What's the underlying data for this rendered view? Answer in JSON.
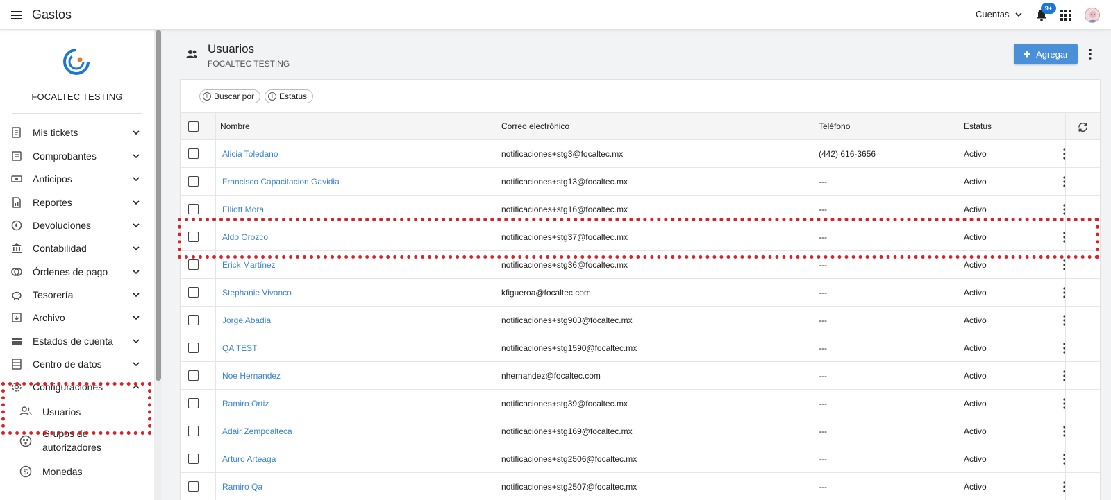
{
  "topbar": {
    "app_title": "Gastos",
    "accounts_label": "Cuentas",
    "notifications_badge": "9+"
  },
  "sidebar": {
    "brand_name": "FOCALTEC TESTING",
    "items": [
      {
        "label": "Mis tickets",
        "icon": "ticket-icon"
      },
      {
        "label": "Comprobantes",
        "icon": "receipt-icon"
      },
      {
        "label": "Anticipos",
        "icon": "cash-icon"
      },
      {
        "label": "Reportes",
        "icon": "report-icon"
      },
      {
        "label": "Devoluciones",
        "icon": "return-icon"
      },
      {
        "label": "Contabilidad",
        "icon": "bank-icon"
      },
      {
        "label": "Órdenes de pago",
        "icon": "coins-icon"
      },
      {
        "label": "Tesorería",
        "icon": "piggy-bank-icon"
      },
      {
        "label": "Archivo",
        "icon": "archive-icon"
      },
      {
        "label": "Estados de cuenta",
        "icon": "wallet-icon"
      },
      {
        "label": "Centro de datos",
        "icon": "data-center-icon"
      },
      {
        "label": "Configuraciones",
        "icon": "gear-icon",
        "expanded": true
      }
    ],
    "sub_items": [
      {
        "label": "Usuarios",
        "icon": "users-icon"
      },
      {
        "label": "Grupos de autorizadores",
        "icon": "group-icon"
      },
      {
        "label": "Monedas",
        "icon": "currency-icon"
      }
    ]
  },
  "page": {
    "title": "Usuarios",
    "subtitle": "FOCALTEC TESTING",
    "add_label": "Agregar"
  },
  "filters": {
    "search_by": "Buscar por",
    "status": "Estatus"
  },
  "table": {
    "columns": [
      "Nombre",
      "Correo electrónico",
      "Teléfono",
      "Estatus"
    ],
    "rows": [
      {
        "name": "Alicia Toledano",
        "email": "notificaciones+stg3@focaltec.mx",
        "phone": "(442) 616-3656",
        "status": "Activo"
      },
      {
        "name": "Francisco Capacitacion Gavidia",
        "email": "notificaciones+stg13@focaltec.mx",
        "phone": "---",
        "status": "Activo"
      },
      {
        "name": "Elliott Mora",
        "email": "notificaciones+stg16@focaltec.mx",
        "phone": "---",
        "status": "Activo"
      },
      {
        "name": "Aldo Orozco",
        "email": "notificaciones+stg37@focaltec.mx",
        "phone": "---",
        "status": "Activo"
      },
      {
        "name": "Erick Martínez",
        "email": "notificaciones+stg36@focaltec.mx",
        "phone": "---",
        "status": "Activo"
      },
      {
        "name": "Stephanie Vivanco",
        "email": "kfigueroa@focaltec.com",
        "phone": "---",
        "status": "Activo"
      },
      {
        "name": "Jorge Abadia",
        "email": "notificaciones+stg903@focaltec.mx",
        "phone": "---",
        "status": "Activo"
      },
      {
        "name": "QA TEST",
        "email": "notificaciones+stg1590@focaltec.mx",
        "phone": "---",
        "status": "Activo"
      },
      {
        "name": "Noe Hernandez",
        "email": "nhernandez@focaltec.com",
        "phone": "---",
        "status": "Activo"
      },
      {
        "name": "Ramiro Ortiz",
        "email": "notificaciones+stg39@focaltec.mx",
        "phone": "---",
        "status": "Activo"
      },
      {
        "name": "Adair Zempoalteca",
        "email": "notificaciones+stg169@focaltec.mx",
        "phone": "---",
        "status": "Activo"
      },
      {
        "name": "Arturo Arteaga",
        "email": "notificaciones+stg2506@focaltec.mx",
        "phone": "---",
        "status": "Activo"
      },
      {
        "name": "Ramiro Qa",
        "email": "notificaciones+stg2507@focaltec.mx",
        "phone": "---",
        "status": "Activo"
      }
    ]
  },
  "colors": {
    "accent": "#4a90d9",
    "link": "#3b85cc",
    "highlight": "#d9232a"
  }
}
